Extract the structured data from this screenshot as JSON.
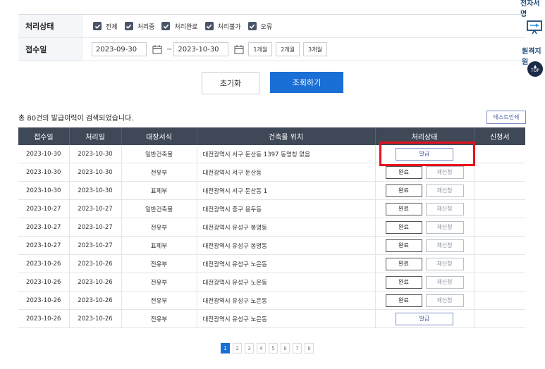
{
  "side": {
    "top_link": "전자서명",
    "remote_label": "원격지원",
    "top_button": "TOP"
  },
  "filter": {
    "status_label": "처리상태",
    "status_options": [
      "전체",
      "처리중",
      "처리완료",
      "처리불가",
      "오류"
    ],
    "date_label": "접수일",
    "date_from": "2023-09-30",
    "date_to": "2023-10-30",
    "tilde": "~",
    "period_buttons": [
      "1개월",
      "2개월",
      "3개월"
    ]
  },
  "actions": {
    "reset_label": "초기화",
    "search_label": "조회하기"
  },
  "results": {
    "summary": "총 80건의 발급이력이 검색되었습니다.",
    "test_print_label": "테스트인쇄"
  },
  "table": {
    "headers": [
      "접수일",
      "처리일",
      "대장서식",
      "건축물 위치",
      "처리상태",
      "신청서"
    ],
    "rows": [
      {
        "received": "2023-10-30",
        "processed": "2023-10-30",
        "form": "일반건축물",
        "location": "대전광역시 서구 둔산동 1397 동명칭 없음",
        "status": "발급",
        "reapply": ""
      },
      {
        "received": "2023-10-30",
        "processed": "2023-10-30",
        "form": "전유부",
        "location": "대전광역시 서구 둔산동",
        "status": "완료",
        "reapply": "재신청"
      },
      {
        "received": "2023-10-30",
        "processed": "2023-10-30",
        "form": "표제부",
        "location": "대전광역시 서구 둔산동 1",
        "status": "완료",
        "reapply": "재신청"
      },
      {
        "received": "2023-10-27",
        "processed": "2023-10-27",
        "form": "일반건축물",
        "location": "대전광역시 중구 용두동",
        "status": "완료",
        "reapply": "재신청"
      },
      {
        "received": "2023-10-27",
        "processed": "2023-10-27",
        "form": "전유부",
        "location": "대전광역시 유성구 봉명동",
        "status": "완료",
        "reapply": "재신청"
      },
      {
        "received": "2023-10-27",
        "processed": "2023-10-27",
        "form": "표제부",
        "location": "대전광역시 유성구 봉명동",
        "status": "완료",
        "reapply": "재신청"
      },
      {
        "received": "2023-10-26",
        "processed": "2023-10-26",
        "form": "전유부",
        "location": "대전광역시 유성구 노은동",
        "status": "완료",
        "reapply": "재신청"
      },
      {
        "received": "2023-10-26",
        "processed": "2023-10-26",
        "form": "전유부",
        "location": "대전광역시 유성구 노은동",
        "status": "완료",
        "reapply": "재신청"
      },
      {
        "received": "2023-10-26",
        "processed": "2023-10-26",
        "form": "전유부",
        "location": "대전광역시 유성구 노은동",
        "status": "완료",
        "reapply": "재신청"
      },
      {
        "received": "2023-10-26",
        "processed": "2023-10-26",
        "form": "전유부",
        "location": "대전광역시 유성구 노은동",
        "status": "발급",
        "reapply": ""
      }
    ]
  },
  "pagination": {
    "pages": [
      "1",
      "2",
      "3",
      "4",
      "5",
      "6",
      "7",
      "8"
    ],
    "current": "1"
  },
  "colors": {
    "accent": "#1a6fd6",
    "header_bg": "#3f4857",
    "highlight": "#e8101b"
  }
}
